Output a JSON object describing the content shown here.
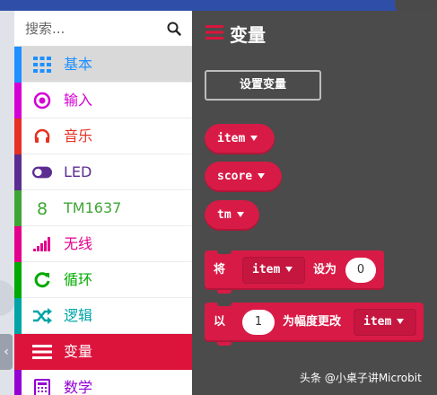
{
  "search": {
    "placeholder": "搜索..."
  },
  "categories": [
    {
      "label": "基本",
      "icon": "grid-icon",
      "color": "#1e90ff",
      "state": "selected"
    },
    {
      "label": "输入",
      "icon": "radio-target-icon",
      "color": "#d400d4",
      "state": ""
    },
    {
      "label": "音乐",
      "icon": "headphones-icon",
      "color": "#e63022",
      "state": ""
    },
    {
      "label": "LED",
      "icon": "toggle-icon",
      "color": "#5c2d91",
      "state": ""
    },
    {
      "label": "TM1637",
      "icon": "digit-eight-icon",
      "color": "#3fa535",
      "state": ""
    },
    {
      "label": "无线",
      "icon": "signal-bars-icon",
      "color": "#e3008c",
      "state": ""
    },
    {
      "label": "循环",
      "icon": "refresh-icon",
      "color": "#00aa00",
      "state": ""
    },
    {
      "label": "逻辑",
      "icon": "shuffle-icon",
      "color": "#00a4a6",
      "state": ""
    },
    {
      "label": "变量",
      "icon": "list-lines-icon",
      "color": "#dc143c",
      "state": "active"
    },
    {
      "label": "数学",
      "icon": "calculator-icon",
      "color": "#9400d3",
      "state": ""
    }
  ],
  "flyout": {
    "title": "变量",
    "make_variable_button": "设置变量",
    "variables": [
      "item",
      "score",
      "tm"
    ],
    "set_block": {
      "keyword": "将",
      "variable": "item",
      "to_label": "设为",
      "value": "0"
    },
    "change_block": {
      "keyword": "以",
      "value": "1",
      "by_label": "为幅度更改",
      "variable": "item"
    }
  },
  "colors": {
    "variables": "#d81b46",
    "flyout_bg": "#4b4b4b",
    "topbar": "#2f4ea8"
  },
  "watermark": "头条 @小桌子讲Microbit",
  "collapse_glyph": "‹"
}
